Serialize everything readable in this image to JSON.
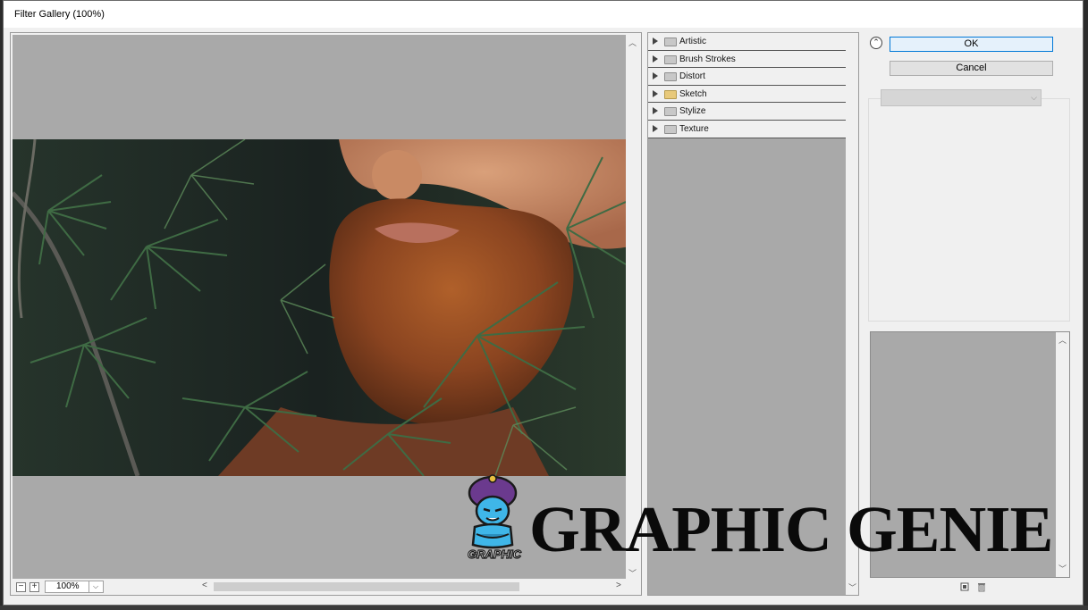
{
  "window": {
    "title": "Filter Gallery (100%)"
  },
  "preview": {
    "zoom_value": "100%",
    "zoom_out_label": "−",
    "zoom_in_label": "+",
    "dropdown_glyph": "⌵",
    "scroll_left_glyph": "<",
    "scroll_right_glyph": ">",
    "scroll_up_glyph": "︿",
    "scroll_down_glyph": "﹀"
  },
  "filters": {
    "items": [
      {
        "label": "Artistic",
        "open": false
      },
      {
        "label": "Brush Strokes",
        "open": false
      },
      {
        "label": "Distort",
        "open": false
      },
      {
        "label": "Sketch",
        "open": true
      },
      {
        "label": "Stylize",
        "open": false
      },
      {
        "label": "Texture",
        "open": false
      }
    ]
  },
  "buttons": {
    "ok": "OK",
    "cancel": "Cancel",
    "collapse_glyph": "⌃"
  },
  "watermark": {
    "text": "GRAPHIC GENIE"
  },
  "icons": {
    "collapse": "double-chevron-up-icon",
    "new_layer": "new-effect-layer-icon",
    "delete_layer": "trash-icon",
    "folder": "folder-icon"
  },
  "colors": {
    "accent": "#0078d7",
    "canvas_gray": "#a9a9a9",
    "folder_open": "#e8c97a"
  }
}
